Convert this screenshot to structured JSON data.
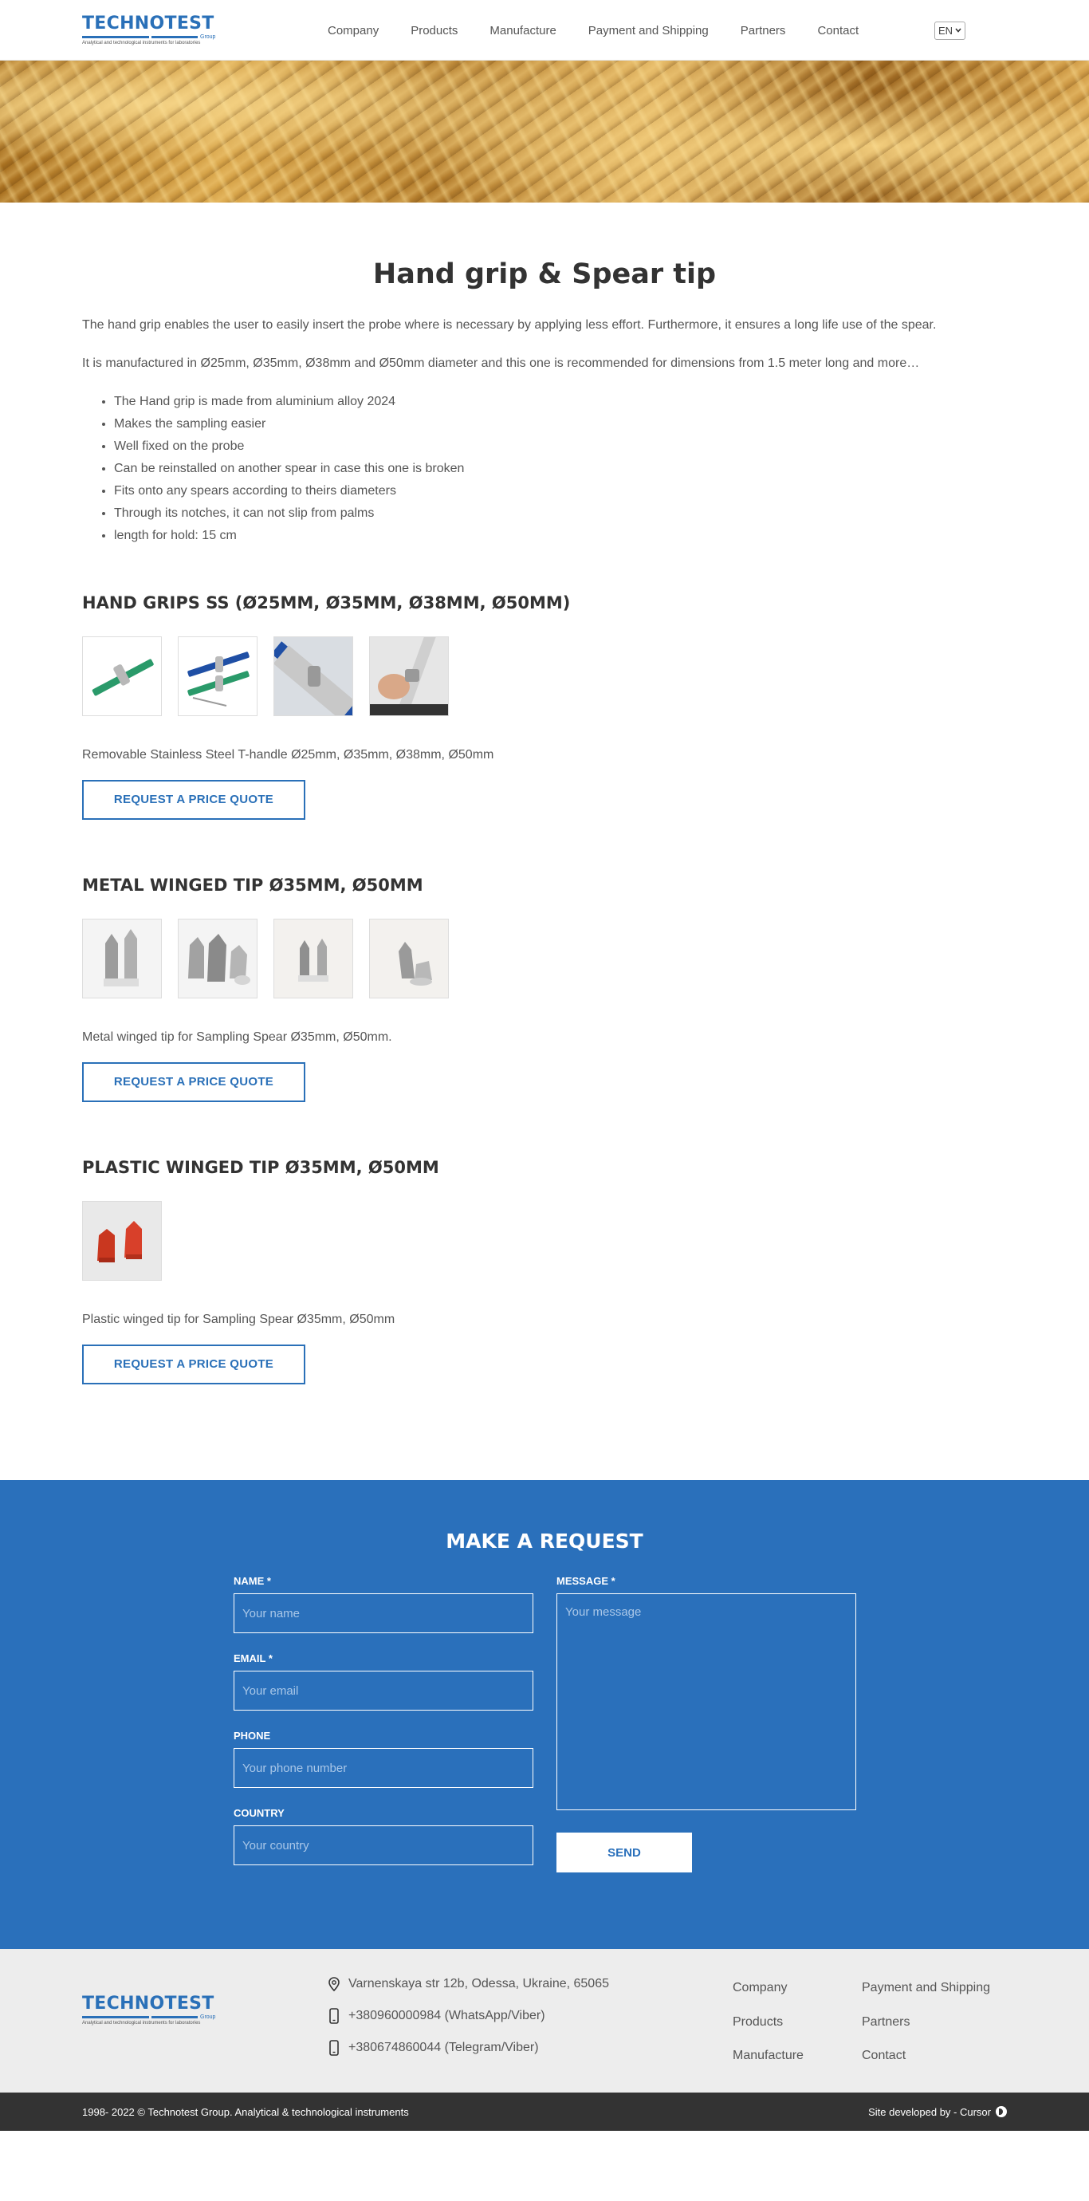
{
  "brand": {
    "name": "TECHNOTEST",
    "group": "Group",
    "tagline": "Analytical and technological instruments for laboratories"
  },
  "nav": {
    "items": [
      "Company",
      "Products",
      "Manufacture",
      "Payment and Shipping",
      "Partners",
      "Contact"
    ],
    "language": "EN"
  },
  "page": {
    "title": "Hand grip & Spear tip",
    "intro": [
      "The hand grip enables the user to easily insert the probe where is necessary by applying less effort. Furthermore, it ensures a long life use of the spear.",
      "It is manufactured in Ø25mm, Ø35mm, Ø38mm and Ø50mm diameter and this one is recommended for dimensions from 1.5 meter long and more…"
    ],
    "features": [
      "The Hand grip is made from aluminium alloy 2024",
      "Makes the sampling easier",
      "Well fixed on the probe",
      "Can be reinstalled on another spear in case this one is broken",
      "Fits onto any spears according to theirs diameters",
      "Through its notches, it can not slip from palms",
      "length for hold: 15 cm"
    ]
  },
  "products": [
    {
      "title": "Hand grips SS (Ø25mm, Ø35mm, Ø38mm, Ø50mm)",
      "description": "Removable Stainless Steel T-handle Ø25mm, Ø35mm, Ø38mm, Ø50mm",
      "button": "Request a price quote"
    },
    {
      "title": "Metal winged tip Ø35mm, Ø50mm",
      "description": "Metal winged tip for Sampling Spear Ø35mm, Ø50mm.",
      "button": "Request a price quote"
    },
    {
      "title": "Plastic winged tip Ø35mm, Ø50mm",
      "description": "Plastic winged tip for Sampling Spear Ø35mm, Ø50mm",
      "button": "Request a price quote"
    }
  ],
  "request_form": {
    "title": "Make a request",
    "name_label": "Name *",
    "name_placeholder": "Your name",
    "email_label": "Email *",
    "email_placeholder": "Your email",
    "phone_label": "Phone",
    "phone_placeholder": "Your phone number",
    "country_label": "Country",
    "country_placeholder": "Your country",
    "message_label": "Message *",
    "message_placeholder": "Your message",
    "send_label": "Send"
  },
  "footer": {
    "address": "Varnenskaya str 12b, Odessa, Ukraine, 65065",
    "phone1": "+380960000984 (WhatsApp/Viber)",
    "phone2": "+380674860044 (Telegram/Viber)",
    "links": [
      "Company",
      "Payment and Shipping",
      "Products",
      "Partners",
      "Manufacture",
      "Contact"
    ],
    "copyright": "1998- 2022 © Technotest Group. Analytical & technological instruments",
    "developer": "Site developed by - Cursor"
  },
  "colors": {
    "primary": "#2a70bb",
    "footer_bg": "#ededed",
    "bottom_bar": "#333333"
  }
}
